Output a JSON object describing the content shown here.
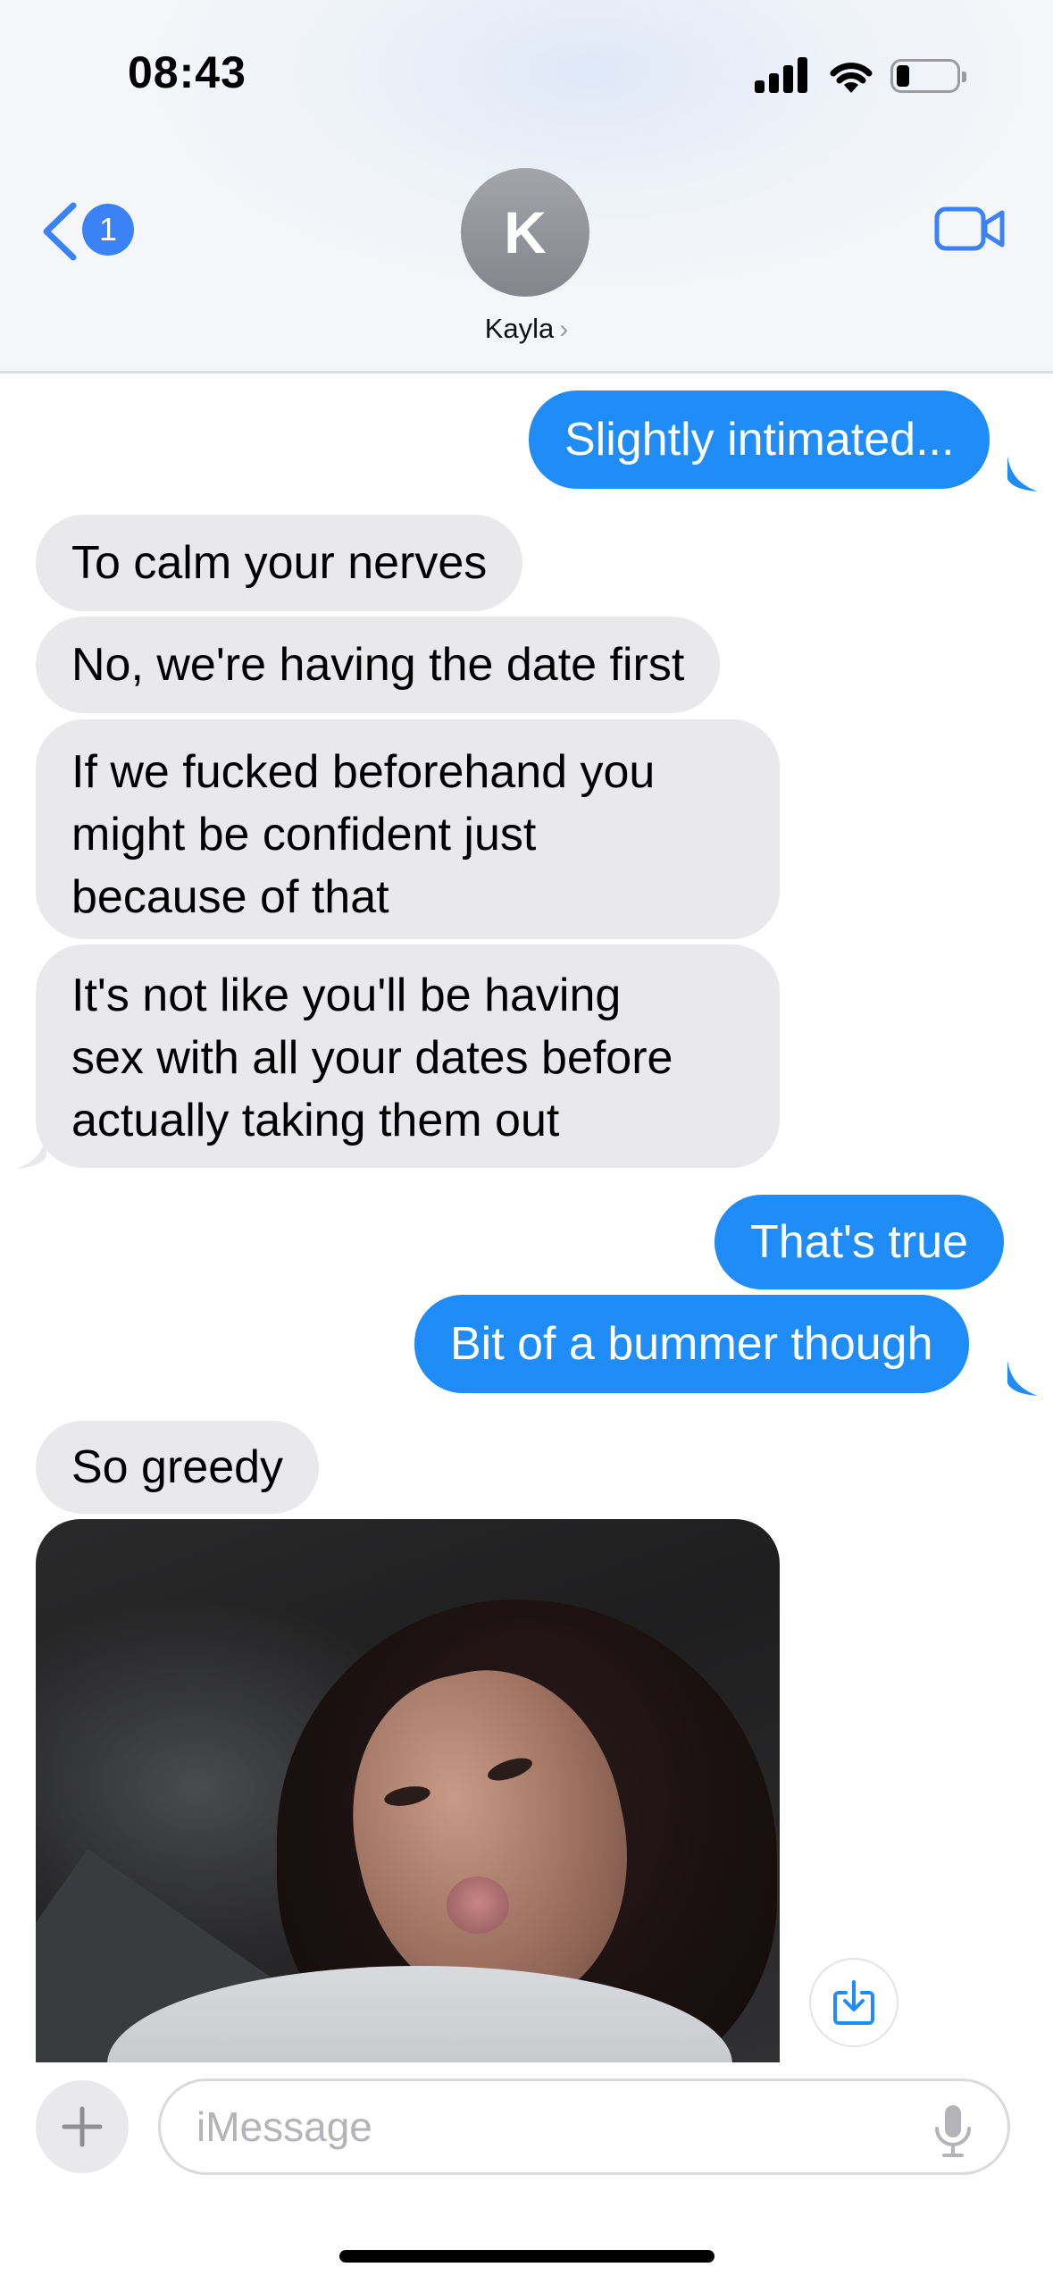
{
  "status_bar": {
    "time": "08:43"
  },
  "header": {
    "back_badge": "1",
    "avatar_initial": "K",
    "contact_name": "Kayla",
    "name_chevron": "›",
    "icons": {
      "back": "chevron-left-icon",
      "video": "video-camera-icon"
    }
  },
  "messages": [
    {
      "side": "out",
      "text": "Slightly intimated..."
    },
    {
      "side": "in",
      "text": "To calm your nerves"
    },
    {
      "side": "in",
      "text": "No, we're having the date first"
    },
    {
      "side": "in",
      "lines": [
        "If we fucked beforehand you",
        "might be confident just",
        "because of that"
      ]
    },
    {
      "side": "in",
      "lines": [
        "It's not like you'll be having",
        "sex with all your dates before",
        "actually taking them out"
      ]
    },
    {
      "side": "out",
      "text": "That's true"
    },
    {
      "side": "out",
      "text": "Bit of a bummer though"
    },
    {
      "side": "in",
      "text": "So greedy"
    },
    {
      "side": "in",
      "type": "photo"
    }
  ],
  "composer": {
    "placeholder": "iMessage",
    "icons": {
      "add": "plus-icon",
      "dictate": "microphone-icon",
      "save": "save-download-icon"
    }
  },
  "colors": {
    "outgoing": "#1f8cf8",
    "incoming": "#e9e9eb",
    "accent": "#3b82f6"
  }
}
